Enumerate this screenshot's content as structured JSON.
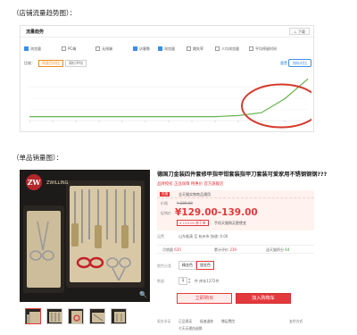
{
  "captions": {
    "traffic": "（店铺流量趋势图）：",
    "sales": "（单品销量图）："
  },
  "traffic_panel": {
    "title": "流量趋势",
    "download_label": "⊥ 下载",
    "checkboxes": [
      {
        "label": "浏览量",
        "checked": true
      },
      {
        "label": "PC端",
        "checked": false
      },
      {
        "label": "无线端",
        "checked": false
      },
      {
        "label": "访客数",
        "checked": true
      },
      {
        "label": "浏览量",
        "checked": true
      },
      {
        "label": "跳失率",
        "checked": false
      },
      {
        "label": "人均浏览量",
        "checked": false
      },
      {
        "label": "平均停留时间",
        "checked": false
      }
    ],
    "tab_label": "比较：",
    "tabs": [
      {
        "label": "同类目对比",
        "active": true
      },
      {
        "label": "同行平均",
        "active": false
      }
    ],
    "link_label": "重置",
    "secondary_button": "指标对比"
  },
  "traffic_chart": {
    "type": "line",
    "series": [
      {
        "values": [
          4,
          4,
          4,
          4,
          4,
          4,
          4,
          4,
          4,
          5,
          8,
          22,
          42
        ]
      }
    ],
    "ylim": [
      0,
      45
    ],
    "grid": true,
    "colors": {
      "line": "#66b34d",
      "highlight_ellipse": "#d33a2c",
      "tick": "#bbbbbb"
    }
  },
  "product": {
    "title": "德国刀金装四件套修甲指甲钳套装指甲刀套装可爱家用不锈钢钢钢???",
    "subtitle": "品牌授权 正品保障 特惠价 官方旗舰店",
    "brand_logo_text": "ZWILLING",
    "promo_tag": "天猫",
    "promo_text": "全天猫实物商品通用",
    "orig_price_label": "价格",
    "orig_price": "¥ 289.00",
    "price_label": "促销价",
    "price": "¥129.00-139.00",
    "coupon": "¥ 129.00 券下单",
    "coupon_note": "手机天猫购买更便宜",
    "ship_label": "运费",
    "ship_value": "山东临清 至 杭州市  快递: 0.00",
    "stats": [
      {
        "label": "月销量",
        "value": "635"
      },
      {
        "label": "累计评价",
        "value": "319"
      },
      {
        "label": "送天猫积分",
        "value": "64"
      }
    ],
    "color_label": "颜色分类",
    "colors": [
      {
        "label": "精金色",
        "selected": false
      },
      {
        "label": "银金色",
        "selected": true
      }
    ],
    "qty_label": "数量",
    "qty": "1",
    "qty_stock": "件 库存1272件",
    "buy_label": "立即购买",
    "cart_label": "加入购物车",
    "promise_label": "服务承诺",
    "promise_items": [
      "正品保证",
      "极速退款",
      "赠运费险",
      "七天无理由退换"
    ],
    "promise_more": "支付方式",
    "promise_line2": "七天无理由退换"
  }
}
